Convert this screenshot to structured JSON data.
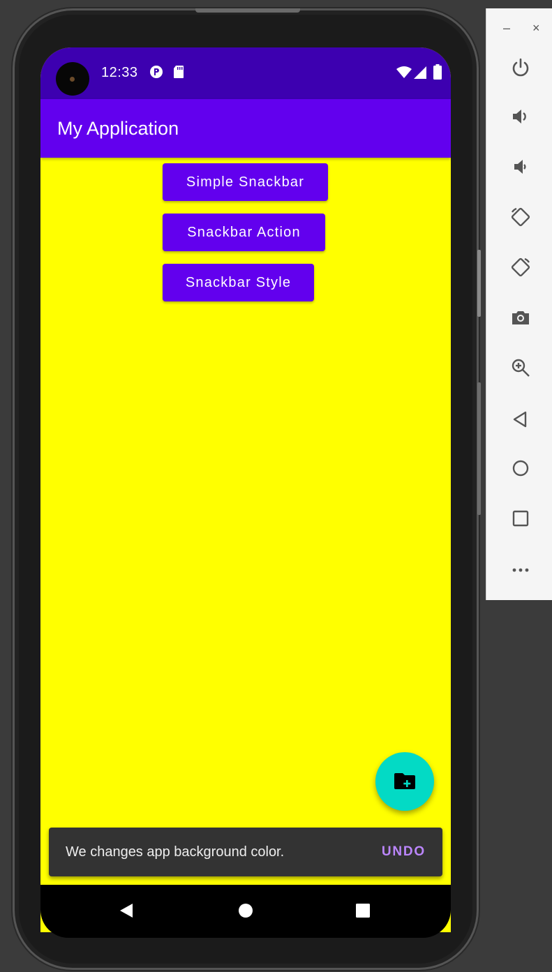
{
  "status_bar": {
    "time": "12:33",
    "left_icons": [
      "camera-icon",
      "sync-icon",
      "sd-card-icon"
    ],
    "right_icons": [
      "wifi-icon",
      "signal-icon",
      "battery-icon"
    ]
  },
  "app_bar": {
    "title": "My Application"
  },
  "buttons": [
    {
      "label": "Simple Snackbar"
    },
    {
      "label": "Snackbar Action"
    },
    {
      "label": "Snackbar Style"
    }
  ],
  "fab": {
    "icon": "create-new-folder-icon"
  },
  "snackbar": {
    "message": "We changes app background color.",
    "action": "UNDO"
  },
  "nav_bar": {
    "icons": [
      "back-icon",
      "home-icon",
      "recents-icon"
    ]
  },
  "emulator_toolbar": {
    "window_controls": {
      "minimize": "–",
      "close": "×"
    },
    "tools": [
      "power-icon",
      "volume-up-icon",
      "volume-down-icon",
      "rotate-left-icon",
      "rotate-right-icon",
      "screenshot-icon",
      "zoom-icon",
      "back-icon",
      "home-icon",
      "overview-icon",
      "more-icon"
    ]
  },
  "colors": {
    "status_bar": "#3d00b0",
    "primary": "#6200ee",
    "background": "#ffff00",
    "fab": "#03dac5",
    "snackbar": "#333333",
    "snackbar_action": "#bb86fc",
    "button_text": "#ffffff"
  }
}
